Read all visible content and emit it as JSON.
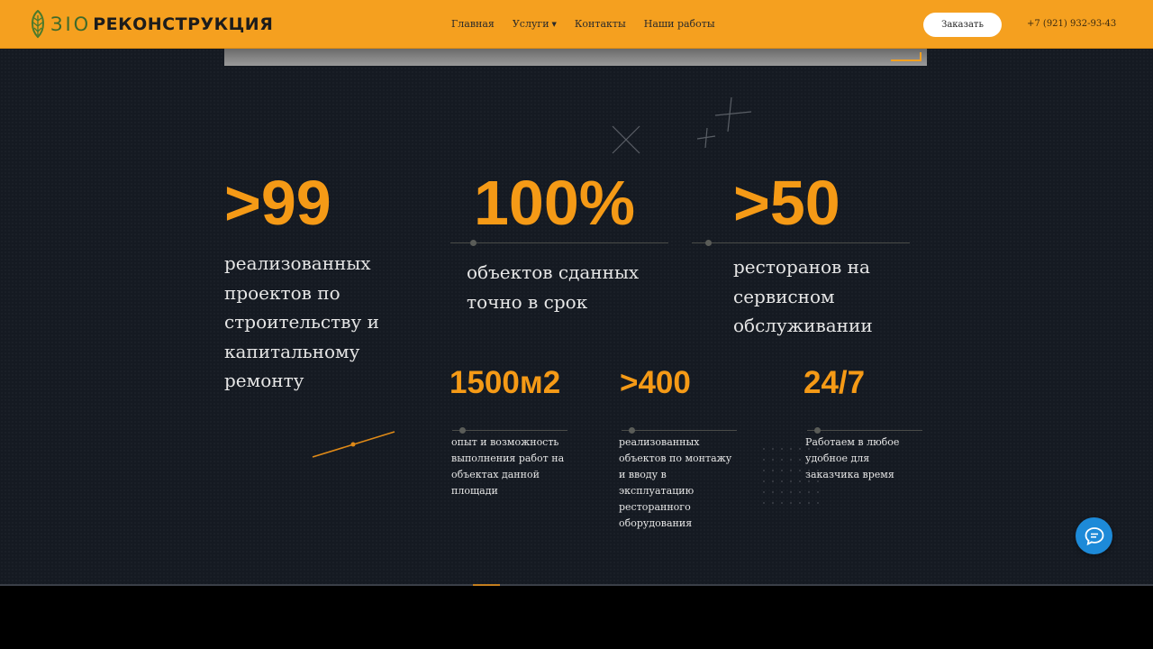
{
  "header": {
    "logo_prefix": "ЗIО",
    "logo_text": "РЕКОНСТРУКЦИЯ",
    "nav": [
      {
        "label": "Главная"
      },
      {
        "label": "Услуги"
      },
      {
        "label": "Контакты"
      },
      {
        "label": "Наши работы"
      }
    ],
    "order_label": "Заказать",
    "phone": "+7 (921) 932-93-43"
  },
  "stats_big": [
    {
      "value": ">99",
      "text": "реализованных проектов по строительству и капитальному ремонту"
    },
    {
      "value": "100%",
      "text": "объектов сданных точно в срок"
    },
    {
      "value": ">50",
      "text": "ресторанов на сервисном обслуживании"
    }
  ],
  "stats_small": [
    {
      "value": "1500м2",
      "text": "опыт и возможность выполнения работ на объектах данной площади"
    },
    {
      "value": ">400",
      "text": "реализованных объектов по монтажу и вводу в эксплуатацию ресторанного оборудования"
    },
    {
      "value": "24/7",
      "text": "Работаем в любое удобное для заказчика время"
    }
  ],
  "colors": {
    "header_bg": "#f5a01f",
    "accent": "#f59a16",
    "page_bg": "#151a22",
    "chat_button": "#1d8ad8"
  },
  "icons": {
    "logo": "leaf-logo-icon",
    "nav_dropdown": "caret-down-icon",
    "chat": "chat-bubble-icon"
  }
}
